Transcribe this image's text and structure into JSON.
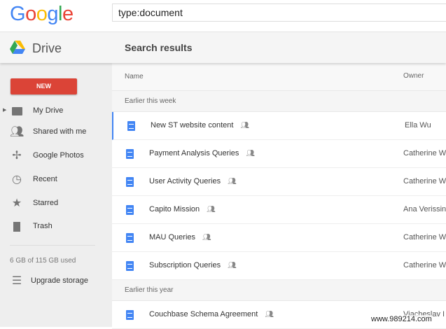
{
  "header": {
    "logo": "Google",
    "search_value": "type:document"
  },
  "subheader": {
    "app_name": "Drive",
    "page_title": "Search results"
  },
  "sidebar": {
    "new_label": "NEW",
    "items": [
      {
        "label": "My Drive",
        "icon": "my-drive-icon"
      },
      {
        "label": "Shared with me",
        "icon": "people-icon"
      },
      {
        "label": "Google Photos",
        "icon": "pinwheel-icon"
      },
      {
        "label": "Recent",
        "icon": "clock-icon"
      },
      {
        "label": "Starred",
        "icon": "star-icon"
      },
      {
        "label": "Trash",
        "icon": "trash-icon"
      }
    ],
    "storage": "6 GB of 115 GB used",
    "upgrade": "Upgrade storage"
  },
  "table": {
    "columns": [
      "Name",
      "Owner"
    ],
    "sections": [
      {
        "label": "Earlier this week",
        "rows": [
          {
            "name": "New ST website content",
            "owner": "Ella Wu"
          },
          {
            "name": "Payment Analysis Queries",
            "owner": "Catherine W"
          },
          {
            "name": "User Activity Queries",
            "owner": "Catherine W"
          },
          {
            "name": "Capito Mission",
            "owner": "Ana Verissin"
          },
          {
            "name": "MAU Queries",
            "owner": "Catherine W"
          },
          {
            "name": "Subscription Queries",
            "owner": "Catherine W"
          }
        ]
      },
      {
        "label": "Earlier this year",
        "rows": [
          {
            "name": "Couchbase Schema Agreement",
            "owner": "Viacheslav I"
          }
        ]
      }
    ]
  },
  "watermark": "www.989214.com",
  "colors": {
    "new_button": "#db4437",
    "doc_icon": "#4285f4",
    "selection": "#4285f4"
  }
}
